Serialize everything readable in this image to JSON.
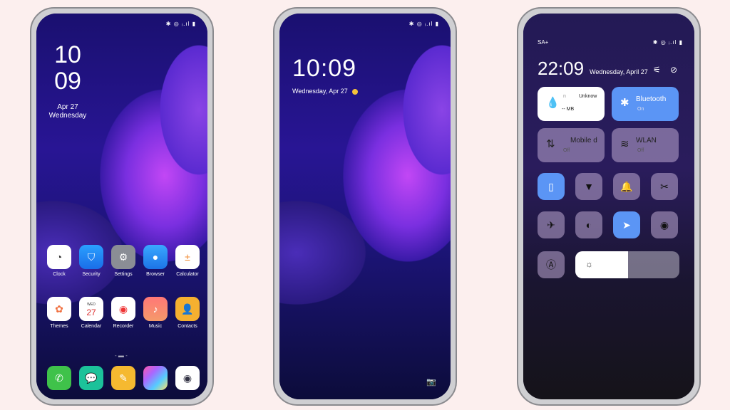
{
  "status_icons": "✱ ◎ ᵢ.ıl ▮",
  "home": {
    "hour": "10",
    "minute": "09",
    "date": "Apr 27",
    "weekday": "Wednesday",
    "row1": [
      {
        "label": "Clock",
        "icon": "clock-icon"
      },
      {
        "label": "Security",
        "icon": "shield-icon"
      },
      {
        "label": "Settings",
        "icon": "gear-icon"
      },
      {
        "label": "Browser",
        "icon": "globe-icon"
      },
      {
        "label": "Calculator",
        "icon": "calculator-icon"
      }
    ],
    "row2": [
      {
        "label": "Themes",
        "icon": "lotus-icon"
      },
      {
        "label": "Calendar",
        "icon": "calendar-icon",
        "day": "WED",
        "date": "27"
      },
      {
        "label": "Recorder",
        "icon": "record-icon"
      },
      {
        "label": "Music",
        "icon": "music-icon"
      },
      {
        "label": "Contacts",
        "icon": "contact-icon"
      }
    ],
    "dock": [
      "phone-icon",
      "message-icon",
      "notes-icon",
      "gallery-icon",
      "camera-icon"
    ]
  },
  "lock": {
    "time": "10:09",
    "date": "Wednesday, Apr 27"
  },
  "control": {
    "carrier": "SA+",
    "time": "22:09",
    "date": "Wednesday, April 27",
    "data_tile": {
      "label": "n",
      "value": "Unknow",
      "usage": "-- MB"
    },
    "bluetooth": {
      "label": "Bluetooth",
      "state": "On"
    },
    "mobile": {
      "label": "Mobile d",
      "state": "Off"
    },
    "wlan": {
      "label": "WLAN",
      "state": "Off"
    },
    "toggles": [
      {
        "icon": "vibrate-icon",
        "on": true
      },
      {
        "icon": "flashlight-icon",
        "on": false
      },
      {
        "icon": "bell-icon",
        "on": false
      },
      {
        "icon": "screenshot-icon",
        "on": false
      },
      {
        "icon": "airplane-icon",
        "on": false
      },
      {
        "icon": "dark-mode-icon",
        "on": false
      },
      {
        "icon": "location-icon",
        "on": true
      },
      {
        "icon": "eye-icon",
        "on": false
      }
    ],
    "brightness_percent": 51
  },
  "colors": {
    "background": "#fcefee",
    "accent": "#5b95f5"
  }
}
